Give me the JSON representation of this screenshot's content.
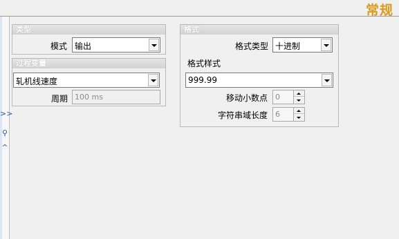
{
  "header": {
    "title": "常规"
  },
  "left_strip": {
    "expand_glyph": ">>",
    "search_glyph": "⚲",
    "collapse_glyph": "^"
  },
  "type_panel": {
    "title": "类型",
    "mode_label": "模式",
    "mode_value": "输出"
  },
  "process_panel": {
    "title": "过程变量",
    "variable_value": "轧机线速度",
    "period_label": "周期",
    "period_value": "100 ms"
  },
  "format_panel": {
    "title": "格式",
    "format_type_label": "格式类型",
    "format_type_value": "十进制",
    "format_style_label": "格式样式",
    "format_style_value": "999.99",
    "decimal_label": "移动小数点",
    "decimal_value": "0",
    "string_length_label": "字符串域长度",
    "string_length_value": "6"
  },
  "colors": {
    "header_title": "#d99a1e",
    "background": "#f0f0f0",
    "panel_title_bg": "#d8d8d8"
  }
}
